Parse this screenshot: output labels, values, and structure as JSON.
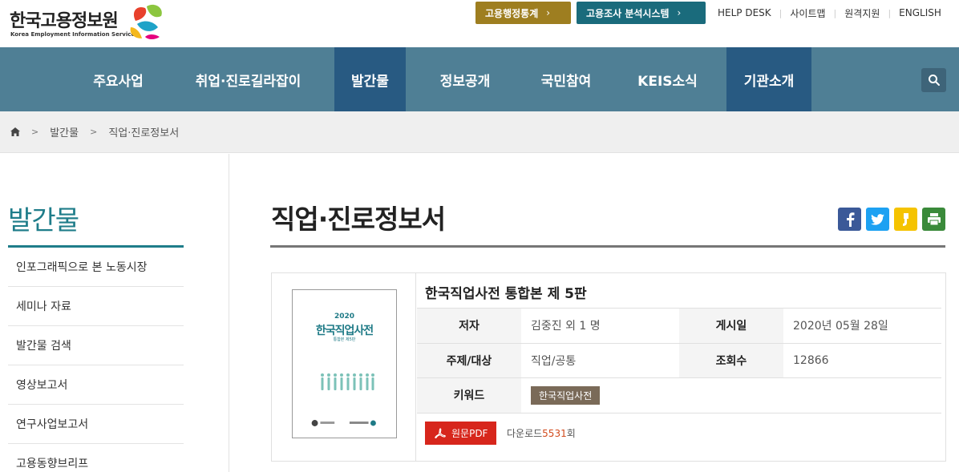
{
  "header": {
    "logo_text": "한국고용정보원",
    "logo_subtext": "Korea Employment Information Service",
    "stats_button": "고용행정통계",
    "analysis_button": "고용조사 분석시스템",
    "util_links": [
      "HELP DESK",
      "사이트맵",
      "원격지원",
      "ENGLISH"
    ]
  },
  "gnb": {
    "items": [
      "주요사업",
      "취업·진로길라잡이",
      "발간물",
      "정보공개",
      "국민참여",
      "KEIS소식",
      "기관소개"
    ],
    "active": [
      "발간물",
      "기관소개"
    ],
    "search_icon": "search-icon"
  },
  "breadcrumb": {
    "home_icon": "home-icon",
    "items": [
      "발간물",
      "직업·진로정보서"
    ]
  },
  "sidebar": {
    "title": "발간물",
    "items": [
      "인포그래픽으로 본 노동시장",
      "세미나 자료",
      "발간물 검색",
      "영상보고서",
      "연구사업보고서",
      "고용동향브리프"
    ]
  },
  "content": {
    "page_title": "직업·진로정보서",
    "share_icons": [
      "facebook-icon",
      "twitter-icon",
      "kakaostory-icon",
      "print-icon"
    ],
    "publication": {
      "cover": {
        "year": "2020",
        "title": "한국직업사전",
        "subtitle": "통합본 제5판"
      },
      "title": "한국직업사전 통합본 제 5판",
      "fields": {
        "author_label": "저자",
        "author_value": "김중진 외 1 명",
        "date_label": "게시일",
        "date_value": "2020년 05월 28일",
        "subject_label": "주제/대상",
        "subject_value": "직업/공통",
        "views_label": "조회수",
        "views_value": "12866",
        "keyword_label": "키워드",
        "keyword_value": "한국직업사전"
      },
      "pdf_button": "원문PDF",
      "download_prefix": "다운로드",
      "download_count": "5531",
      "download_suffix": "회"
    }
  },
  "colors": {
    "gnb_bg": "#4f7f95",
    "gnb_active": "#285a82",
    "accent_teal": "#1f7d8a",
    "stats_btn": "#9e7e20",
    "analysis_btn": "#1a6b7c",
    "pdf_red": "#d7261c"
  }
}
